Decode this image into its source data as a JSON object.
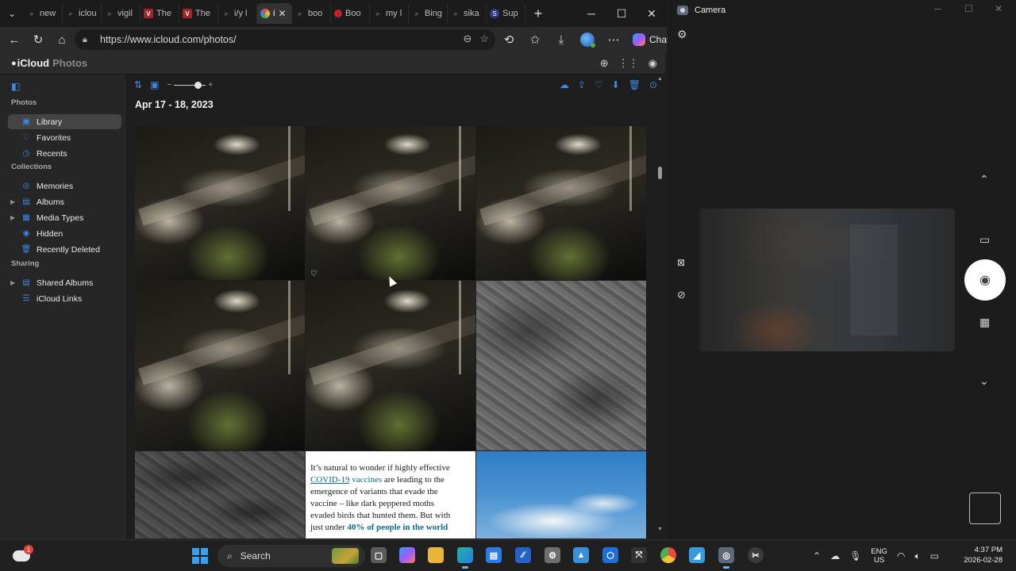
{
  "browser": {
    "tabs": [
      {
        "label": "new",
        "favicon": "search-icon"
      },
      {
        "label": "iclou",
        "favicon": "search-icon"
      },
      {
        "label": "vigil",
        "favicon": "search-icon"
      },
      {
        "label": "The",
        "favicon": "v-logo-icon"
      },
      {
        "label": "The",
        "favicon": "v-logo-icon"
      },
      {
        "label": "i/y l",
        "favicon": "search-icon"
      },
      {
        "label": "i",
        "favicon": "photos-icon",
        "active": true
      },
      {
        "label": "boo",
        "favicon": "search-icon"
      },
      {
        "label": "Boo",
        "favicon": "red-dot-icon"
      },
      {
        "label": "my l",
        "favicon": "search-icon"
      },
      {
        "label": "Bing",
        "favicon": "search-icon"
      },
      {
        "label": "sika",
        "favicon": "search-icon"
      },
      {
        "label": "Sup",
        "favicon": "s-logo-icon"
      }
    ],
    "url": "https://www.icloud.com/photos/",
    "chat_label": "Chat"
  },
  "icloud": {
    "brand": "iCloud",
    "section": "Photos",
    "sidebar": {
      "photos_heading": "Photos",
      "photos_items": [
        {
          "label": "Library",
          "icon": "library-icon",
          "selected": true
        },
        {
          "label": "Favorites",
          "icon": "heart-icon"
        },
        {
          "label": "Recents",
          "icon": "clock-icon"
        }
      ],
      "collections_heading": "Collections",
      "collections_items": [
        {
          "label": "Memories",
          "icon": "memories-icon"
        },
        {
          "label": "Albums",
          "icon": "albums-icon",
          "expandable": true
        },
        {
          "label": "Media Types",
          "icon": "media-types-icon",
          "expandable": true
        },
        {
          "label": "Hidden",
          "icon": "eye-icon"
        },
        {
          "label": "Recently Deleted",
          "icon": "trash-icon"
        }
      ],
      "sharing_heading": "Sharing",
      "sharing_items": [
        {
          "label": "Shared Albums",
          "icon": "shared-albums-icon",
          "expandable": true
        },
        {
          "label": "iCloud Links",
          "icon": "link-icon"
        }
      ]
    },
    "date_heading": "Apr 17 - 18, 2023",
    "zoom_level": 0.75,
    "photos": [
      {
        "kind": "night-tree"
      },
      {
        "kind": "night-tree",
        "favorite_icon": true
      },
      {
        "kind": "night-tree"
      },
      {
        "kind": "night-tree"
      },
      {
        "kind": "night-tree"
      },
      {
        "kind": "pavement-shadows"
      },
      {
        "kind": "pavement-shadows"
      },
      {
        "kind": "article-screenshot"
      },
      {
        "kind": "sky-clouds"
      }
    ],
    "article_text": {
      "line1": "It’s natural to wonder if highly effective",
      "link1": "COVID-19",
      "link2": "vaccines",
      "line2_rest": " are leading to the",
      "line3": "emergence of variants that evade the",
      "line4": "vaccine – like dark peppered moths",
      "line5": "evaded birds that hunted them. But with",
      "line6_start": "just under ",
      "bold_link": "40% of people in the world"
    }
  },
  "camera": {
    "title": "Camera"
  },
  "taskbar": {
    "weather_badge": "1",
    "search_label": "Search",
    "lang_top": "ENG",
    "lang_bottom": "US",
    "time": "4:37 PM",
    "date": "2026-02-28"
  },
  "colors": {
    "accent": "#3d8ae6",
    "sidebar_bg": "#262626",
    "selected_bg": "#444444"
  }
}
